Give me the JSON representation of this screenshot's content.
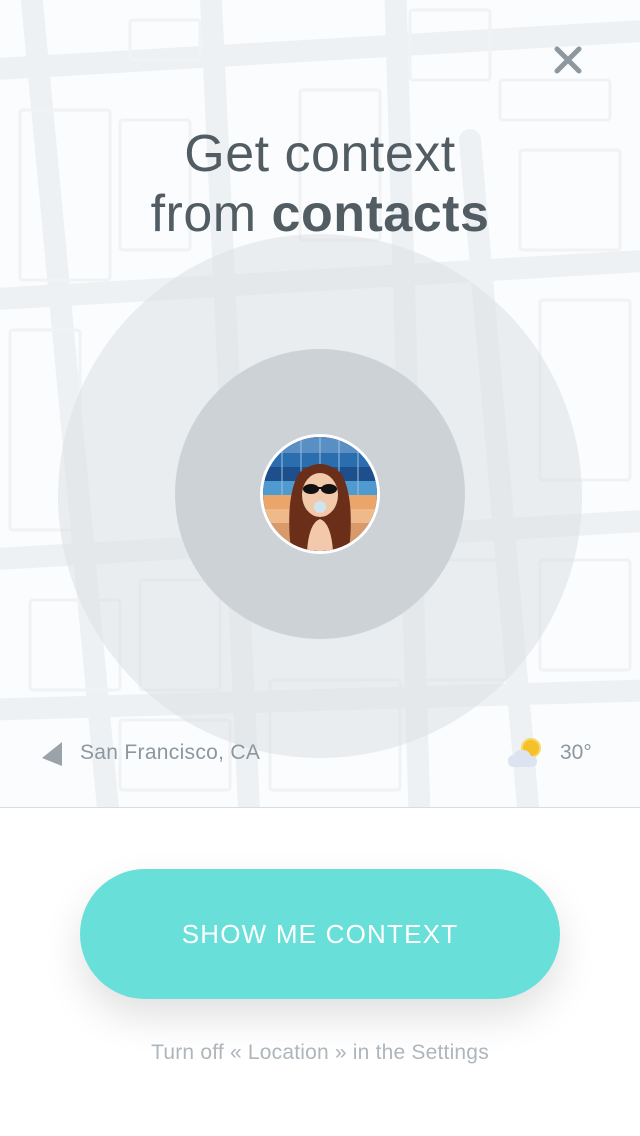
{
  "title": {
    "line1": "Get context",
    "line2_prefix": "from ",
    "line2_bold": "contacts"
  },
  "location": {
    "icon": "location-arrow-icon",
    "text": "San Francisco, CA"
  },
  "weather": {
    "icon": "partly-cloudy-icon",
    "temperature": "30°"
  },
  "cta": {
    "label": "SHOW ME CONTEXT"
  },
  "footnote": "Turn off « Location » in the Settings",
  "colors": {
    "accent": "#69dfd9",
    "title": "#525c63",
    "muted": "#8d979e",
    "footnote": "#aeb6bc"
  }
}
